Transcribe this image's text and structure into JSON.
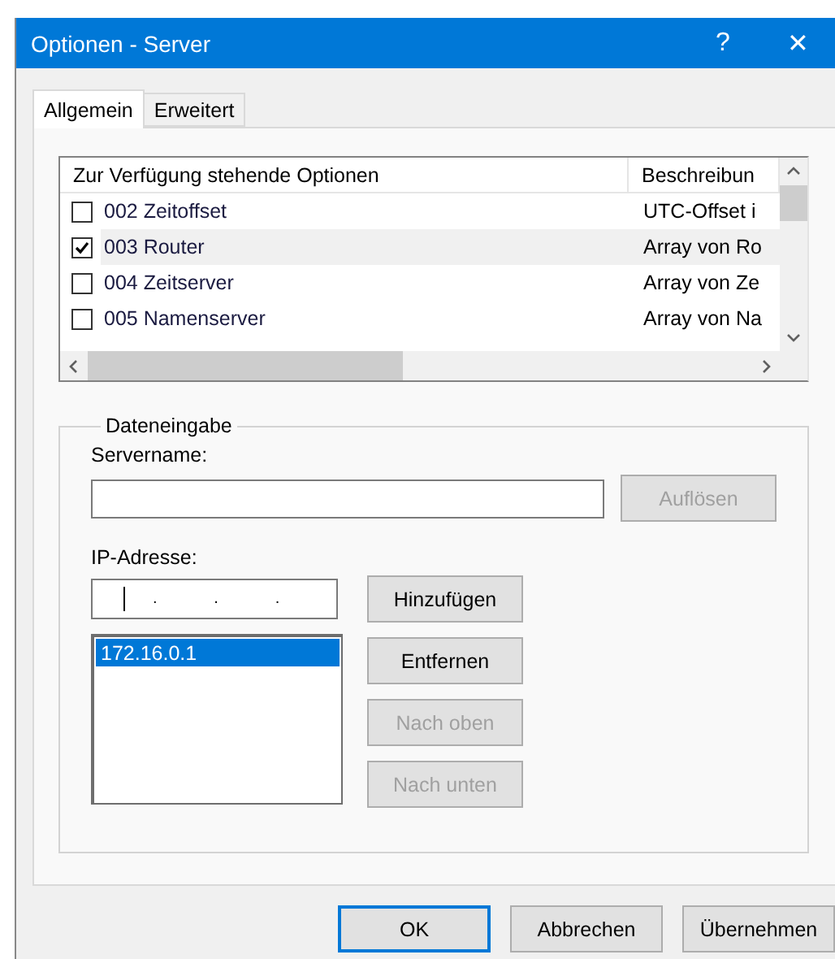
{
  "window": {
    "title": "Optionen - Server",
    "help": "?",
    "close": "✕"
  },
  "tabs": [
    {
      "label": "Allgemein",
      "selected": true
    },
    {
      "label": "Erweitert",
      "selected": false
    }
  ],
  "options_list": {
    "columns": [
      "Zur Verfügung stehende Optionen",
      "Beschreibun"
    ],
    "rows": [
      {
        "option": "002 Zeitoffset",
        "description": "UTC-Offset i",
        "checked": false,
        "selected": false
      },
      {
        "option": "003 Router",
        "description": "Array von Ro",
        "checked": true,
        "selected": true
      },
      {
        "option": "004 Zeitserver",
        "description": "Array von Ze",
        "checked": false,
        "selected": false
      },
      {
        "option": "005 Namenserver",
        "description": "Array von Na",
        "checked": false,
        "selected": false
      }
    ]
  },
  "data_entry": {
    "title": "Dateneingabe",
    "server_name_label": "Servername:",
    "resolve_button": {
      "label": "Auflösen",
      "disabled": true
    },
    "ip_label": "IP-Adresse:",
    "ip_separator": ".",
    "ip_list": [
      {
        "address": "172.16.0.1",
        "selected": true
      }
    ],
    "buttons": [
      {
        "label": "Hinzufügen",
        "disabled": false
      },
      {
        "label": "Entfernen",
        "disabled": false
      },
      {
        "label": "Nach oben",
        "disabled": true
      },
      {
        "label": "Nach unten",
        "disabled": true
      }
    ]
  },
  "footer_buttons": [
    {
      "label": "OK",
      "default": true
    },
    {
      "label": "Abbrechen",
      "default": false
    },
    {
      "label": "Übernehmen",
      "default": false
    }
  ]
}
